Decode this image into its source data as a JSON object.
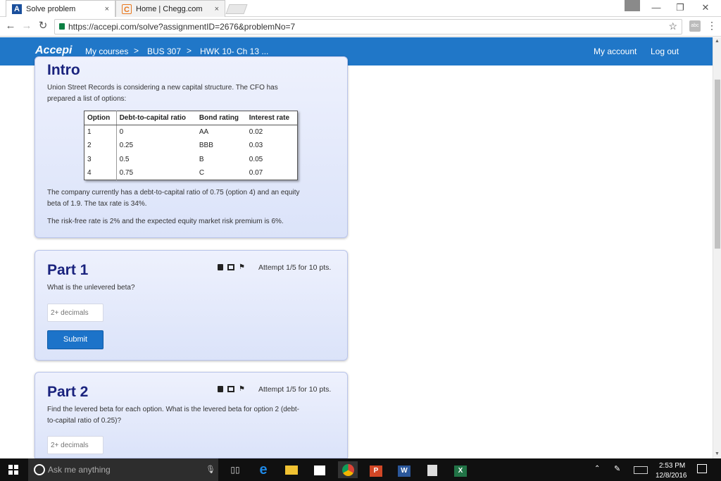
{
  "browser": {
    "tabs": [
      {
        "label": "Solve problem",
        "close": "×",
        "icon": "accepi-icon"
      },
      {
        "label": "Home | Chegg.com",
        "close": "×",
        "icon": "chegg-icon"
      }
    ],
    "url": "https://accepi.com/solve?assignmentID=2676&problemNo=7",
    "window_buttons": {
      "minimize": "—",
      "maximize": "❐",
      "close": "✕"
    },
    "ext_label": "abc"
  },
  "site": {
    "logo": "Accepi",
    "nav": {
      "my_courses": "My courses",
      "sep1": ">",
      "course": "BUS 307",
      "sep2": ">",
      "homework": "HWK 10- Ch 13 ...",
      "my_account": "My account",
      "log_out": "Log out"
    }
  },
  "intro": {
    "title": "Intro",
    "p1_line1": "Union Street Records is considering a new capital structure. The CFO has",
    "p1_line2": "prepared a list of options:",
    "table": {
      "headers": [
        "Option",
        "Debt-to-capital ratio",
        "Bond rating",
        "Interest rate"
      ],
      "rows": [
        [
          "1",
          "0",
          "AA",
          "0.02"
        ],
        [
          "2",
          "0.25",
          "BBB",
          "0.03"
        ],
        [
          "3",
          "0.5",
          "B",
          "0.05"
        ],
        [
          "4",
          "0.75",
          "C",
          "0.07"
        ]
      ]
    },
    "p2_line1": "The company currently has a debt-to-capital ratio of 0.75 (option 4) and an equity",
    "p2_line2": "beta of 1.9. The tax rate is 34%.",
    "p3": "The risk-free rate is 2% and the expected equity market risk premium is 6%."
  },
  "part1": {
    "title": "Part 1",
    "attempt": "Attempt 1/5 for 10 pts.",
    "question": "What is the unlevered beta?",
    "placeholder": "2+ decimals",
    "submit": "Submit"
  },
  "part2": {
    "title": "Part 2",
    "attempt": "Attempt 1/5 for 10 pts.",
    "question_line1": "Find the levered beta for each option. What is the levered beta for option 2 (debt-",
    "question_line2": "to-capital ratio of 0.25)?",
    "placeholder": "2+ decimals"
  },
  "taskbar": {
    "search_text": "Ask me anything",
    "apps": [
      "P",
      "W",
      "X"
    ],
    "time": "2:53 PM",
    "date": "12/8/2016"
  },
  "colors": {
    "header_blue": "#2077c8",
    "title_navy": "#1a237e",
    "submit_blue": "#1c73c9"
  }
}
